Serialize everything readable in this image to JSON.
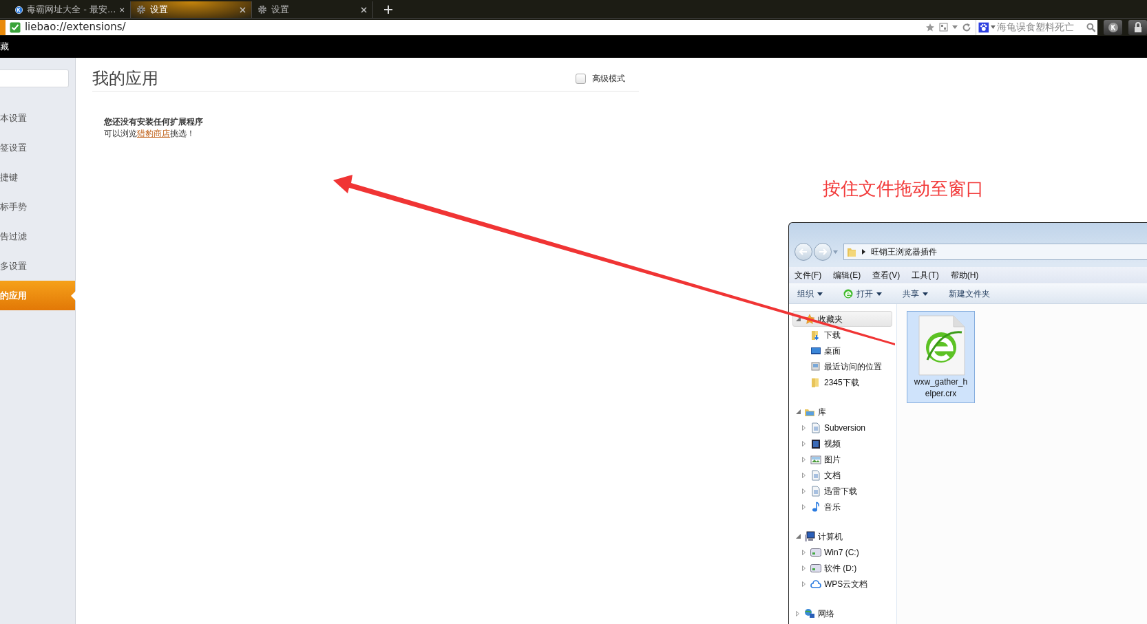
{
  "browser_tabs": [
    {
      "label": "毒霸网址大全 - 最安...",
      "kind": "site",
      "selected": false
    },
    {
      "label": "设置",
      "kind": "settings",
      "selected": true
    },
    {
      "label": "设置",
      "kind": "settings",
      "selected": false
    }
  ],
  "address_bar": {
    "url": "liebao://extensions/",
    "search_value": "海龟误食塑料死亡"
  },
  "bookmarks_bar": {
    "text": "藏"
  },
  "sidebar": {
    "items": [
      {
        "label": "本设置",
        "selected": false
      },
      {
        "label": "签设置",
        "selected": false
      },
      {
        "label": "捷键",
        "selected": false
      },
      {
        "label": "标手势",
        "selected": false
      },
      {
        "label": "告过滤",
        "selected": false
      },
      {
        "label": "多设置",
        "selected": false
      },
      {
        "label": "的应用",
        "selected": true
      }
    ]
  },
  "page": {
    "title": "我的应用",
    "advanced_mode": {
      "label": "高级模式",
      "checked": false
    },
    "empty_title": "您还没有安装任何扩展程序",
    "empty_before": "可以浏览",
    "empty_link": "猎豹商店",
    "empty_after": "挑选！"
  },
  "annotation": {
    "text": "按住文件拖动至窗口"
  },
  "explorer": {
    "path": "旺销王浏览器插件",
    "menu": [
      "文件(F)",
      "编辑(E)",
      "查看(V)",
      "工具(T)",
      "帮助(H)"
    ],
    "toolbar": [
      {
        "label": "组织",
        "kind": "menu"
      },
      {
        "label": "打开",
        "kind": "open"
      },
      {
        "label": "共享",
        "kind": "menu"
      },
      {
        "label": "新建文件夹",
        "kind": "plain"
      }
    ],
    "tree": [
      {
        "label": "收藏夹",
        "kind": "star",
        "expanded": true,
        "selected": true,
        "children": [
          {
            "label": "下载",
            "kind": "download"
          },
          {
            "label": "桌面",
            "kind": "desktop"
          },
          {
            "label": "最近访问的位置",
            "kind": "recent"
          },
          {
            "label": "2345下载",
            "kind": "folder"
          }
        ]
      },
      {
        "label": "库",
        "kind": "library",
        "expanded": true,
        "selected": false,
        "children": [
          {
            "label": "Subversion",
            "kind": "doc",
            "expanded": false
          },
          {
            "label": "视频",
            "kind": "video",
            "expanded": false
          },
          {
            "label": "图片",
            "kind": "image",
            "expanded": false
          },
          {
            "label": "文档",
            "kind": "doc",
            "expanded": false
          },
          {
            "label": "迅雷下载",
            "kind": "doc",
            "expanded": false
          },
          {
            "label": "音乐",
            "kind": "music",
            "expanded": false
          }
        ]
      },
      {
        "label": "计算机",
        "kind": "computer",
        "expanded": true,
        "selected": false,
        "children": [
          {
            "label": "Win7 (C:)",
            "kind": "drive",
            "expanded": false
          },
          {
            "label": "软件 (D:)",
            "kind": "drive",
            "expanded": false
          },
          {
            "label": "WPS云文档",
            "kind": "cloud",
            "expanded": false
          }
        ]
      },
      {
        "label": "网络",
        "kind": "network",
        "expanded": false,
        "selected": false
      }
    ],
    "files": [
      {
        "name": "wxw_gather_helper.crx",
        "selected": true
      }
    ]
  }
}
